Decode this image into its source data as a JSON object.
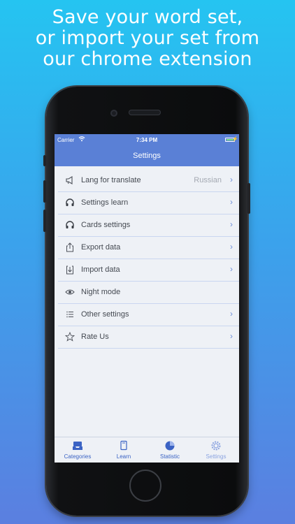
{
  "headline": {
    "line1": "Save your word set,",
    "line2": "or import your set from",
    "line3": "our chrome extension"
  },
  "status_bar": {
    "carrier": "Carrier",
    "time": "7:34 PM"
  },
  "nav": {
    "title": "Settings"
  },
  "settings_items": [
    {
      "label": "Lang for translate",
      "value": "Russian",
      "icon": "megaphone-icon",
      "chevron": true
    },
    {
      "label": "Settings learn",
      "icon": "headphones-icon",
      "chevron": true
    },
    {
      "label": "Cards settings",
      "icon": "headphones-icon",
      "chevron": true
    },
    {
      "label": "Export data",
      "icon": "share-icon",
      "chevron": true
    },
    {
      "label": "Import data",
      "icon": "download-icon",
      "chevron": true
    },
    {
      "label": "Night mode",
      "icon": "eye-icon",
      "chevron": false
    },
    {
      "label": "Other settings",
      "icon": "list-icon",
      "chevron": true
    },
    {
      "label": "Rate Us",
      "icon": "star-icon",
      "chevron": true
    }
  ],
  "tabs": [
    {
      "label": "Categories",
      "icon": "inbox-tray-icon",
      "active": false
    },
    {
      "label": "Learn",
      "icon": "card-icon",
      "active": false
    },
    {
      "label": "Statistic",
      "icon": "pie-chart-icon",
      "active": false
    },
    {
      "label": "Settings",
      "icon": "gear-icon",
      "active": true
    }
  ],
  "colors": {
    "accent": "#5a80d6",
    "tab_inactive": "#3b63c4",
    "tab_active": "#8aa3e0",
    "list_text": "#454a52",
    "value_text": "#a4a9b2"
  }
}
